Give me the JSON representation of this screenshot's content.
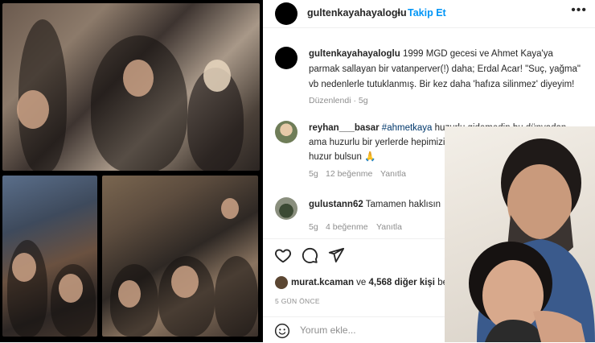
{
  "post": {
    "username": "gultenkayahayaloglu",
    "follow_label": "Takip Et",
    "more_label": "•••",
    "caption_text": " 1999 MGD gecesi ve Ahmet Kaya'ya parmak sallayan bir vatanperver(!) daha; Erdal Acar! \"Suç, yağma\" vb nedenlerle tutuklanmış. Bir kez daha 'hafıza silinmez' diyeyim!",
    "edited_label": "Düzenlendi · 5g"
  },
  "comments": [
    {
      "username": "reyhan___basar",
      "hashtag": "#ahmetkaya",
      "text": " huzurlu gidemedin bu dünyadan ama huzurlu bir yerlerde hepimizi izliyorsun biliyorum daim ruhu huzur bulsun 🙏",
      "time": "5g",
      "likes": "12 beğenme",
      "reply": "Yanıtla"
    },
    {
      "username": "gulustann62",
      "text": " Tamamen haklısın",
      "time": "5g",
      "likes": "4 beğenme",
      "reply": "Yanıtla"
    }
  ],
  "likes_line": {
    "user": "murat.kcaman",
    "connector": " ve ",
    "others": "4,568 diğer kişi",
    "suffix": " beğendi"
  },
  "timestamp": "5 GÜN ÖNCE",
  "composer": {
    "placeholder": "Yorum ekle..."
  },
  "icons": [
    "heart-icon",
    "comment-icon",
    "share-icon",
    "emoji-icon"
  ],
  "colors": {
    "link": "#0095f6",
    "hashtag": "#00376b",
    "muted": "#8e8e8e"
  }
}
